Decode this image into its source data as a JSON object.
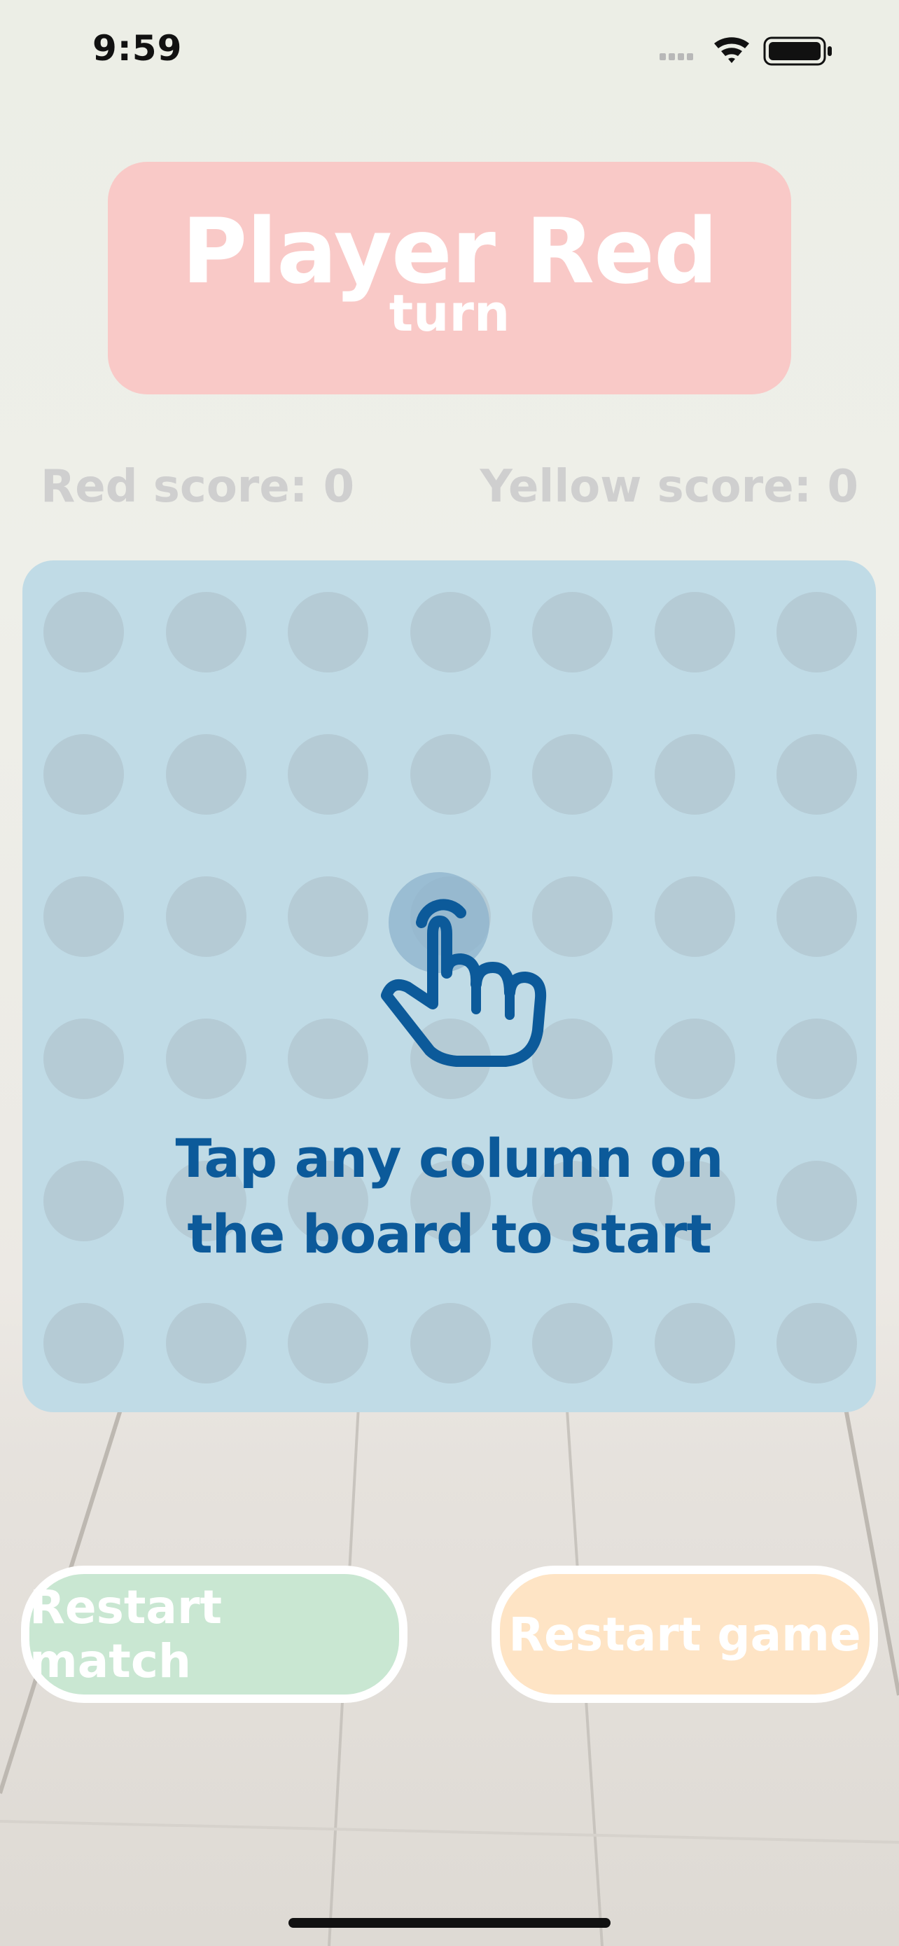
{
  "status_bar": {
    "time": "9:59"
  },
  "turn_banner": {
    "player": "Player Red",
    "subtitle": "turn"
  },
  "scores": {
    "red": "Red score: 0",
    "yellow": "Yellow score: 0"
  },
  "board": {
    "columns": 7,
    "rows": 6
  },
  "hint": {
    "line1": "Tap any column on",
    "line2": "the board to start"
  },
  "buttons": {
    "restart_match": "Restart match",
    "restart_game": "Restart game"
  },
  "colors": {
    "banner": "#f9c9c7",
    "board": "#c0dbe6",
    "hint_text": "#0c5a9a",
    "restart_match": "#c9e7d2",
    "restart_game": "#fee4c5"
  }
}
